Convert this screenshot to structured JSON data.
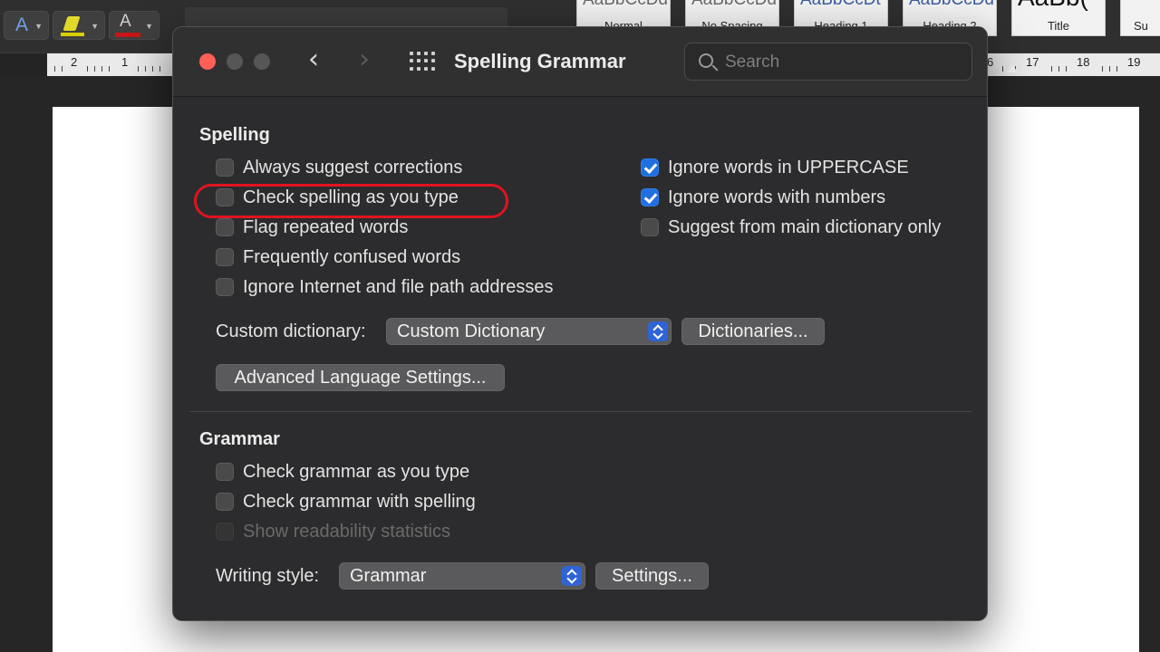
{
  "ribbon": {
    "font_icon": "A",
    "font_color_icon": "A",
    "styles": [
      {
        "sample": "AaBbCcDd",
        "name": "Normal"
      },
      {
        "sample": "AaBbCcDd",
        "name": "No Spacing"
      },
      {
        "sample": "AaBbCcDt",
        "name": "Heading 1"
      },
      {
        "sample": "AaBbCcDd",
        "name": "Heading 2"
      },
      {
        "sample": "AaBb(",
        "name": "Title"
      },
      {
        "sample": "",
        "name": "Su"
      }
    ],
    "colors": {
      "highlight": "#d8d000",
      "font_color": "#c41818"
    }
  },
  "ruler": {
    "labels_left": [
      "2",
      "1"
    ],
    "labels_right": [
      "17",
      "18",
      "19"
    ],
    "partial_label": "6"
  },
  "dialog": {
    "title": "Spelling  Grammar",
    "icons": [
      "close-traffic-light",
      "minimize-traffic-light",
      "zoom-traffic-light",
      "chevron-left-icon",
      "chevron-right-icon",
      "grid-icon",
      "search-icon"
    ],
    "search": {
      "placeholder": "Search",
      "value": ""
    },
    "spelling": {
      "title": "Spelling",
      "left_options": [
        {
          "label": "Always suggest corrections",
          "checked": false
        },
        {
          "label": "Check spelling as you type",
          "checked": false
        },
        {
          "label": "Flag repeated words",
          "checked": false
        },
        {
          "label": "Frequently confused words",
          "checked": false
        },
        {
          "label": "Ignore Internet and file path addresses",
          "checked": false
        }
      ],
      "right_options": [
        {
          "label": "Ignore words in UPPERCASE",
          "checked": true
        },
        {
          "label": "Ignore words with numbers",
          "checked": true
        },
        {
          "label": "Suggest from main dictionary only",
          "checked": false
        }
      ],
      "custom_dictionary_label": "Custom dictionary:",
      "custom_dictionary_value": "Custom Dictionary",
      "dictionaries_button": "Dictionaries...",
      "advanced_button": "Advanced Language Settings..."
    },
    "grammar": {
      "title": "Grammar",
      "options": [
        {
          "label": "Check grammar as you type",
          "checked": false,
          "enabled": true
        },
        {
          "label": "Check grammar with spelling",
          "checked": false,
          "enabled": true
        },
        {
          "label": "Show readability statistics",
          "checked": false,
          "enabled": false
        }
      ],
      "writing_style_label": "Writing style:",
      "writing_style_value": "Grammar",
      "settings_button": "Settings..."
    },
    "colors": {
      "accent": "#1f6fe0",
      "annotation": "#e0141f",
      "close": "#ff5f57"
    }
  }
}
